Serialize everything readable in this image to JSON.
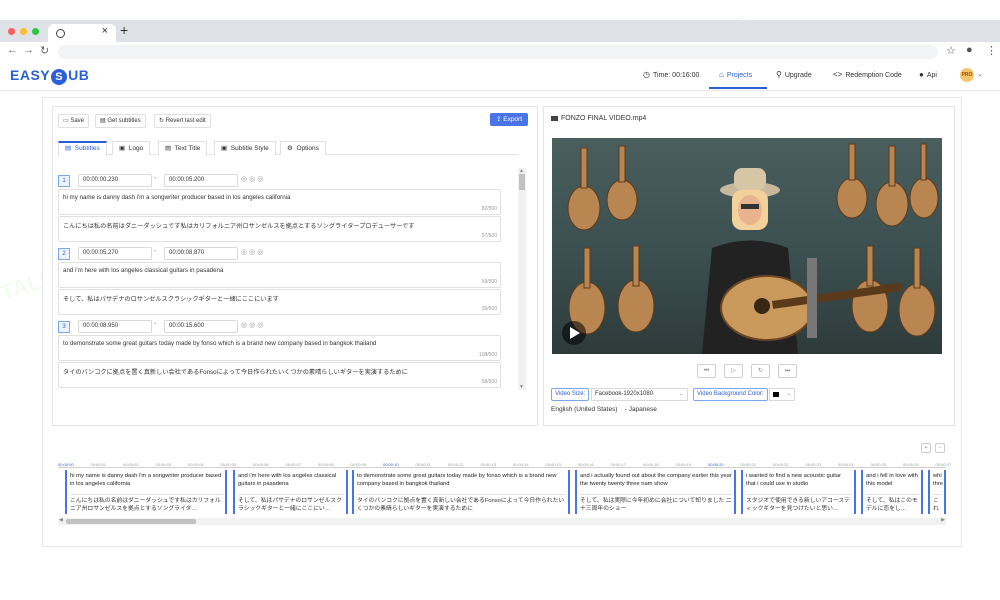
{
  "browser": {
    "tab_close": "×",
    "new_tab": "+"
  },
  "app": {
    "logo_left": "EASY",
    "logo_mark": "S",
    "logo_right": "UB",
    "time_label": "Time: 00:16:00",
    "nav": [
      {
        "label": "Projects",
        "icon": "home-icon"
      },
      {
        "label": "Upgrade",
        "icon": "upgrade-icon"
      },
      {
        "label": "Redemption Code",
        "icon": "code-icon"
      },
      {
        "label": "Api",
        "icon": "github-icon"
      }
    ],
    "pro_badge": "PRO"
  },
  "toolbar": {
    "save": "Save",
    "get_subtitles": "Get subtitles",
    "revert": "Revert last edit",
    "export": "Export"
  },
  "tabs": [
    "Subtitles",
    "Logo",
    "Text Title",
    "Subtitle Style",
    "Options"
  ],
  "subtitles": [
    {
      "index": "1",
      "start": "00:00:00.230",
      "end": "00:00:05.200",
      "en": "hi my name is danny dash i'm a songwriter producer based in los angeles california",
      "en_count": "82/500",
      "jp": "こんにちは私の名前はダニーダッシュです私はカリフォルニア州ロサンゼルスを拠点とするソングライタープロデューサーです",
      "jp_count": "57/500"
    },
    {
      "index": "2",
      "start": "00:00:05.270",
      "end": "00:00:08.870",
      "en": "and i'm here with los angeles classical guitars in pasadena",
      "en_count": "59/500",
      "jp": "そして、私はパサデナのロサンゼルスクラシックギターと一緒にここにいます",
      "jp_count": "35/500"
    },
    {
      "index": "3",
      "start": "00:00:08.950",
      "end": "00:00:15.600",
      "en": "to demonstrate some great guitars today made by fonso which is a brand new company based in bangkok thailand",
      "en_count": "108/500",
      "jp": "タイのバンコクに拠点を置く真新しい会社であるFonsoによって今日作られたいくつかの素晴らしいギターを実演するために",
      "jp_count": "58/500"
    }
  ],
  "dash": "-",
  "video": {
    "filename": "FONZO FINAL VIDEO.mp4",
    "size_label": "Video Size:",
    "size_value": "Facebook-1920x1080",
    "bg_label": "Video Background Color:",
    "bg_color": "#000000",
    "lang_primary": "English (United States)",
    "lang_secondary": "- Japanese"
  },
  "timeline": {
    "ticks": [
      "00:00:00",
      "00:00:01",
      "00:00:02",
      "00:00:03",
      "00:00:04",
      "00:00:05",
      "00:00:06",
      "00:00:07",
      "00:00:08",
      "00:00:09",
      "00:00:10",
      "00:00:11",
      "00:00:12",
      "00:00:13",
      "00:00:14",
      "00:00:15",
      "00:00:16",
      "00:00:17",
      "00:00:18",
      "00:00:19",
      "00:00:20",
      "00:00:21",
      "00:00:22",
      "00:00:23",
      "00:00:24",
      "00:00:25",
      "00:00:26",
      "00:00:27"
    ],
    "cues": [
      {
        "en": "hi my name is danny dash i'm a songwriter producer based in los angeles california",
        "jp": "こんにちは私の名前はダニーダッシュです私はカリフォルニア州ロサンゼルスを拠点とするソングライタ…"
      },
      {
        "en": "and i'm here with los angeles classical guitars in pasadena",
        "jp": "そして、私はパサデナのロサンゼルスクラシックギターと一緒にここにい…"
      },
      {
        "en": "to demonstrate some great guitars today made by fonso which is a brand new company based in bangkok thailand",
        "jp": "タイのバンコクに拠点を置く真新しい会社であるFonsoによって今日作られたいくつかの素晴らしいギターを実演するために"
      },
      {
        "en": "and i actually found out about the company earlier this year the twenty twenty three nam show",
        "jp": "そして、私は実際に今年初めに会社について知りました 二十三周年のショー"
      },
      {
        "en": "i wanted to find a new acoustic guitar that i could use in studio",
        "jp": "スタジオで使用できる新しいアコースティックギターを見つけたいと思い…"
      },
      {
        "en": "and i fell in love with this model",
        "jp": "そして、私はこのモデルに恋をし…"
      },
      {
        "en": "whi thre",
        "jp": "これ"
      }
    ]
  }
}
